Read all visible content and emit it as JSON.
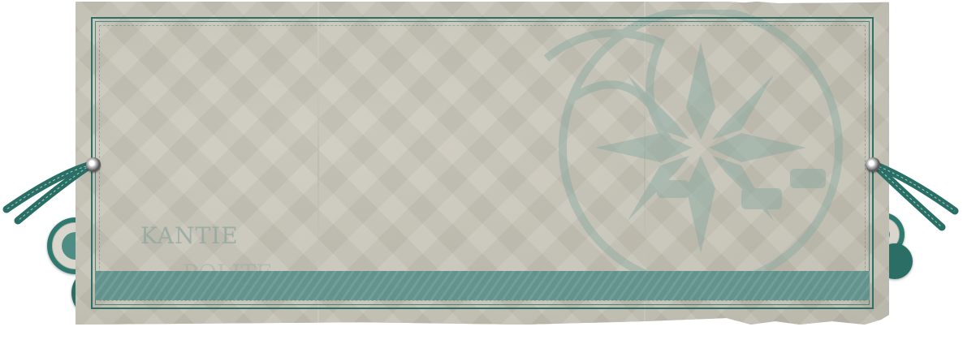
{
  "card": {
    "watermark_text": "KANTIE",
    "watermark_text_2": "POLITE"
  },
  "colors": {
    "paper": "#c6c3b6",
    "accent_teal": "#2f6f68",
    "band": "#5e918b",
    "ribbon": "#2f7a70"
  },
  "icons": {
    "eyelet_left": "eyelet-icon",
    "eyelet_right": "eyelet-icon",
    "emblem": "compass-rose-emblem-icon"
  }
}
